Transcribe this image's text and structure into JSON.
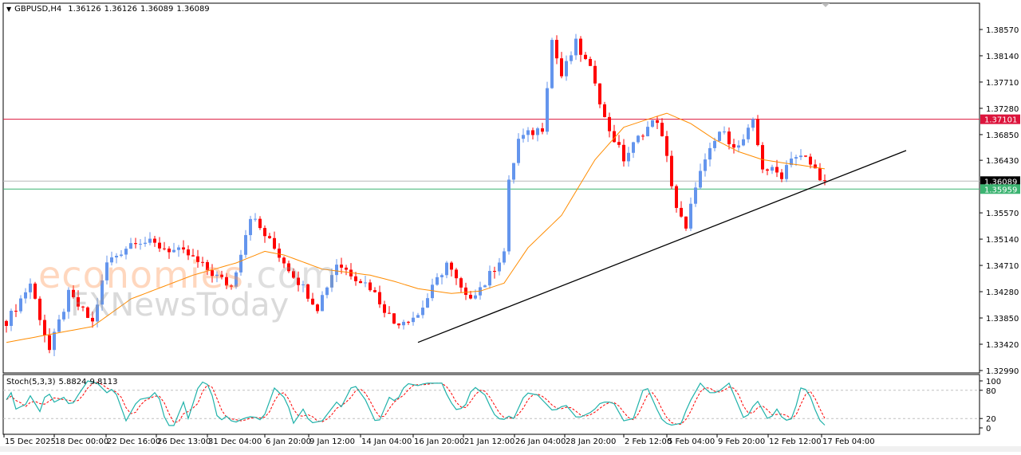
{
  "header": {
    "symbol": "GBPUSD,H4",
    "open": "1.36126",
    "high": "1.36126",
    "low": "1.36089",
    "close": "1.36089"
  },
  "watermark": {
    "line1": "economies",
    "line1b": ".com",
    "line2": "FXNewsToday"
  },
  "colors": {
    "bull": "#6495ED",
    "bear": "#FF0000",
    "ma": "#FF8C00",
    "resistance": "#DC143C",
    "support": "#3CB371",
    "bid": "#000000",
    "stoch_main": "#20B2AA",
    "stoch_signal": "#FF0000"
  },
  "chart_data": [
    {
      "type": "candlestick",
      "title": "GBPUSD,H4",
      "ylim": [
        1.3295,
        1.3895
      ],
      "yticks": [
        "1.38570",
        "1.38140",
        "1.37710",
        "1.37280",
        "1.36850",
        "1.36430",
        "1.35570",
        "1.35140",
        "1.34710",
        "1.34280",
        "1.33850",
        "1.33420",
        "1.32990"
      ],
      "price_labels": [
        {
          "name": "resistance",
          "value": "1.37101",
          "color": "#DC143C"
        },
        {
          "name": "bid",
          "value": "1.36089",
          "color": "#000000"
        },
        {
          "name": "support",
          "value": "1.35959",
          "color": "#3CB371"
        }
      ],
      "xticks": [
        "15 Dec 2025",
        "18 Dec 00:00",
        "22 Dec 16:00",
        "26 Dec 13:00",
        "31 Dec 04:00",
        "6 Jan 20:00",
        "9 Jan 12:00",
        "14 Jan 04:00",
        "16 Jan 20:00",
        "21 Jan 12:00",
        "26 Jan 04:00",
        "28 Jan 20:00",
        "2 Feb 12:00",
        "5 Feb 04:00",
        "9 Feb 20:00",
        "12 Feb 12:00",
        "17 Feb 04:00"
      ],
      "bars": 172,
      "close_path": [
        [
          0,
          1.338
        ],
        [
          1,
          1.339
        ],
        [
          5,
          1.3442
        ],
        [
          9,
          1.3332
        ],
        [
          13,
          1.3423
        ],
        [
          18,
          1.3377
        ],
        [
          21,
          1.3475
        ],
        [
          27,
          1.3514
        ],
        [
          38,
          1.3488
        ],
        [
          40,
          1.3475
        ],
        [
          47,
          1.3436
        ],
        [
          51,
          1.3553
        ],
        [
          57,
          1.3488
        ],
        [
          65,
          1.3403
        ],
        [
          69,
          1.3475
        ],
        [
          76,
          1.3436
        ],
        [
          81,
          1.3377
        ],
        [
          86,
          1.339
        ],
        [
          92,
          1.3475
        ],
        [
          96,
          1.3416
        ],
        [
          100,
          1.3442
        ],
        [
          104,
          1.3494
        ],
        [
          105,
          1.3605
        ],
        [
          107,
          1.3677
        ],
        [
          112,
          1.3697
        ],
        [
          114,
          1.384
        ],
        [
          116,
          1.3781
        ],
        [
          119,
          1.3834
        ],
        [
          123,
          1.3775
        ],
        [
          125,
          1.371
        ],
        [
          129,
          1.3645
        ],
        [
          133,
          1.369
        ],
        [
          136,
          1.371
        ],
        [
          138,
          1.3645
        ],
        [
          140,
          1.3566
        ],
        [
          142,
          1.3527
        ],
        [
          144,
          1.3605
        ],
        [
          149,
          1.369
        ],
        [
          153,
          1.3664
        ],
        [
          156,
          1.3703
        ],
        [
          158,
          1.3632
        ],
        [
          162,
          1.3619
        ],
        [
          164,
          1.3651
        ],
        [
          167,
          1.3645
        ],
        [
          171,
          1.3609
        ]
      ],
      "ma_path": [
        [
          0,
          1.3345
        ],
        [
          18,
          1.3371
        ],
        [
          26,
          1.3416
        ],
        [
          39,
          1.3455
        ],
        [
          48,
          1.3475
        ],
        [
          54,
          1.3494
        ],
        [
          58,
          1.3488
        ],
        [
          66,
          1.3465
        ],
        [
          76,
          1.3455
        ],
        [
          81,
          1.3445
        ],
        [
          86,
          1.3433
        ],
        [
          93,
          1.3425
        ],
        [
          99,
          1.3429
        ],
        [
          104,
          1.3442
        ],
        [
          109,
          1.35
        ],
        [
          116,
          1.3553
        ],
        [
          123,
          1.3644
        ],
        [
          129,
          1.3697
        ],
        [
          134,
          1.371
        ],
        [
          138,
          1.372
        ],
        [
          143,
          1.3703
        ],
        [
          148,
          1.3677
        ],
        [
          153,
          1.3657
        ],
        [
          158,
          1.3644
        ],
        [
          163,
          1.3638
        ],
        [
          166,
          1.3635
        ],
        [
          171,
          1.3629
        ]
      ],
      "horizontal_lines": [
        1.37101,
        1.36089,
        1.35959
      ],
      "trendline": [
        [
          86,
          1.3345
        ],
        [
          188,
          1.3659
        ]
      ]
    },
    {
      "type": "line",
      "title": "Stoch(5,3,3)",
      "main_value": "5.8824",
      "signal_value": "9.8113",
      "ylim": [
        0,
        100
      ],
      "levels": [
        20,
        80
      ],
      "yticks": [
        "100",
        "80",
        "20",
        "0"
      ],
      "main_path": [
        [
          0,
          60
        ],
        [
          1,
          75
        ],
        [
          2,
          40
        ],
        [
          4,
          50
        ],
        [
          4.3,
          80
        ],
        [
          7,
          35
        ],
        [
          8.5,
          80
        ],
        [
          10,
          55
        ],
        [
          12,
          65
        ],
        [
          13.5,
          45
        ],
        [
          15,
          70
        ],
        [
          17,
          100
        ],
        [
          19,
          95
        ],
        [
          21,
          75
        ],
        [
          22.5,
          85
        ],
        [
          25,
          15
        ],
        [
          27.5,
          60
        ],
        [
          30,
          65
        ],
        [
          31.5,
          80
        ],
        [
          33.5,
          5
        ],
        [
          35,
          5
        ],
        [
          37,
          55
        ],
        [
          38,
          20
        ],
        [
          40.5,
          100
        ],
        [
          42.5,
          90
        ],
        [
          44.5,
          5
        ],
        [
          45.5,
          30
        ],
        [
          47.5,
          10
        ],
        [
          49.5,
          20
        ],
        [
          51.5,
          25
        ],
        [
          53.5,
          15
        ],
        [
          56,
          85
        ],
        [
          58.5,
          60
        ],
        [
          60,
          10
        ],
        [
          62,
          40
        ],
        [
          63.5,
          10
        ],
        [
          66,
          15
        ],
        [
          69,
          55
        ],
        [
          70,
          45
        ],
        [
          72.5,
          95
        ],
        [
          75,
          60
        ],
        [
          77.5,
          5
        ],
        [
          80,
          65
        ],
        [
          81.5,
          55
        ],
        [
          83.5,
          95
        ],
        [
          86,
          90
        ],
        [
          87.5,
          95
        ],
        [
          91,
          95
        ],
        [
          92.5,
          60
        ],
        [
          94.3,
          35
        ],
        [
          96,
          50
        ],
        [
          97.5,
          90
        ],
        [
          100,
          70
        ],
        [
          101.8,
          30
        ],
        [
          103.5,
          15
        ],
        [
          105,
          25
        ],
        [
          106,
          20
        ],
        [
          108.5,
          75
        ],
        [
          111,
          70
        ],
        [
          114.3,
          35
        ],
        [
          116.8,
          50
        ],
        [
          119.3,
          20
        ],
        [
          122.5,
          35
        ],
        [
          124.3,
          55
        ],
        [
          126.8,
          55
        ],
        [
          129,
          15
        ],
        [
          131,
          20
        ],
        [
          133.5,
          95
        ],
        [
          136.8,
          20
        ],
        [
          138.5,
          5
        ],
        [
          141,
          10
        ],
        [
          142.5,
          50
        ],
        [
          145,
          95
        ],
        [
          146.8,
          75
        ],
        [
          148.5,
          75
        ],
        [
          151,
          95
        ],
        [
          154.3,
          15
        ],
        [
          156.8,
          60
        ],
        [
          159.3,
          15
        ],
        [
          161,
          40
        ],
        [
          162.5,
          15
        ],
        [
          164.3,
          20
        ],
        [
          166,
          85
        ],
        [
          167.5,
          80
        ],
        [
          169.3,
          30
        ],
        [
          170.5,
          6
        ]
      ]
    }
  ]
}
